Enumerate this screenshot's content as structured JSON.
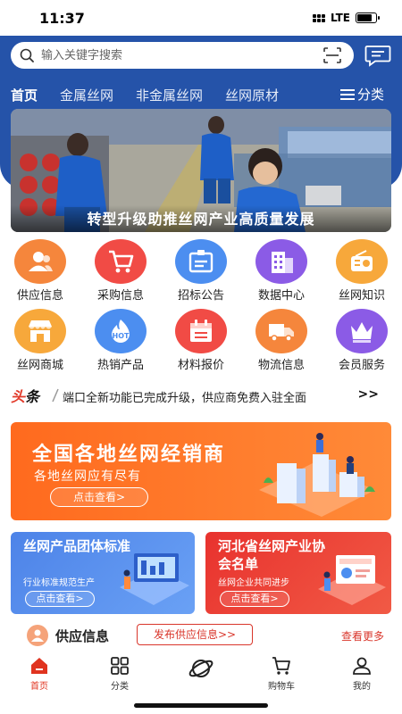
{
  "status_bar": {
    "time": "11:37",
    "network": "LTE",
    "battery_level": 0.8
  },
  "search": {
    "placeholder": "输入关键字搜索",
    "icon": "search-icon",
    "scan_icon": "scan-icon"
  },
  "header": {
    "message_icon": "message-icon"
  },
  "category_tabs": {
    "items": [
      "首页",
      "金属丝网",
      "非金属丝网",
      "丝网原材"
    ],
    "active_index": 0,
    "more_label": "分类"
  },
  "banner": {
    "caption": "转型升级助推丝网产业高质量发展"
  },
  "quick_grid": {
    "items": [
      {
        "label": "供应信息",
        "icon": "users-icon",
        "color": "#f5863c"
      },
      {
        "label": "采购信息",
        "icon": "cart-icon",
        "color": "#f14b45"
      },
      {
        "label": "招标公告",
        "icon": "bid-icon",
        "color": "#4c8ef0"
      },
      {
        "label": "数据中心",
        "icon": "building-icon",
        "color": "#8b5be6"
      },
      {
        "label": "丝网知识",
        "icon": "radio-icon",
        "color": "#f7a83b"
      },
      {
        "label": "丝网商城",
        "icon": "store-icon",
        "color": "#f7a83b"
      },
      {
        "label": "热销产品",
        "icon": "hot-icon",
        "color": "#4c8ef0"
      },
      {
        "label": "材料报价",
        "icon": "calendar-icon",
        "color": "#f14b45"
      },
      {
        "label": "物流信息",
        "icon": "truck-icon",
        "color": "#f5863c"
      },
      {
        "label": "会员服务",
        "icon": "crown-icon",
        "color": "#8b5be6"
      }
    ],
    "hot_text": "HOT"
  },
  "news": {
    "logo_a": "头",
    "logo_b": "条",
    "text": "端口全新功能已完成升级，供应商免费入驻全面",
    "more": ">>"
  },
  "promo_main": {
    "title": "全国各地丝网经销商",
    "subtitle": "各地丝网应有尽有",
    "button": "点击查看>"
  },
  "promo_left": {
    "title": "丝网产品团体标准",
    "subtitle": "行业标准规范生产",
    "button": "点击查看>"
  },
  "promo_right": {
    "title": "河北省丝网产业协会名单",
    "subtitle": "丝网企业共同进步",
    "button": "点击查看>"
  },
  "supply_section": {
    "title": "供应信息",
    "publish_button": "发布供应信息>>",
    "more": "查看更多"
  },
  "tabbar": {
    "items": [
      {
        "label": "首页",
        "icon": "home-icon",
        "active": true
      },
      {
        "label": "分类",
        "icon": "grid-icon",
        "active": false
      },
      {
        "label": "",
        "icon": "planet-icon",
        "active": false
      },
      {
        "label": "购物车",
        "icon": "cart-icon",
        "active": false
      },
      {
        "label": "我的",
        "icon": "user-icon",
        "active": false
      }
    ]
  },
  "colors": {
    "brand_blue": "#2553a9",
    "accent_red": "#e0331f",
    "promo_orange": "#ff6a1e"
  }
}
